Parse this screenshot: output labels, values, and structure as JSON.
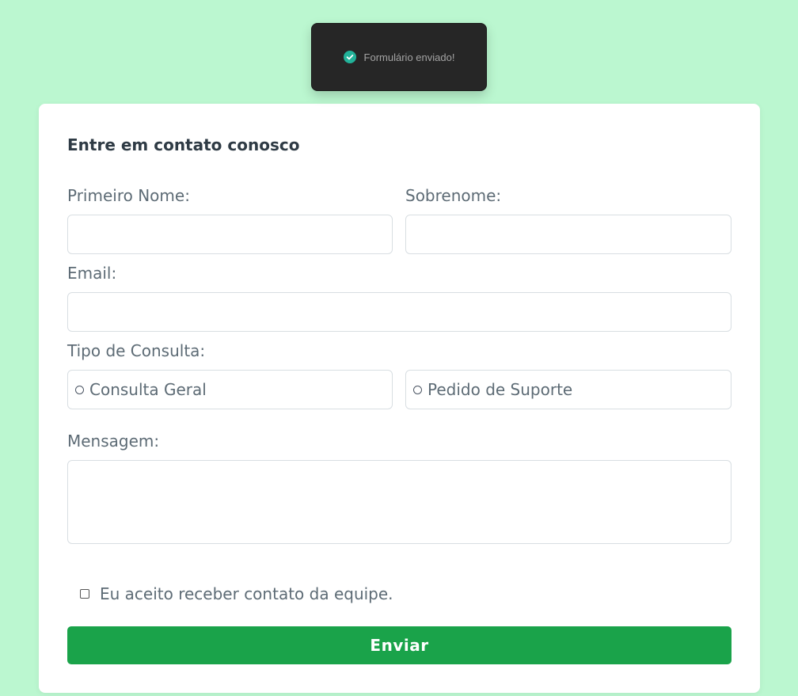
{
  "toast": {
    "message": "Formulário enviado!",
    "icon": "check-circle-icon",
    "icon_color": "#22b39a"
  },
  "form": {
    "title": "Entre em contato conosco",
    "first_name": {
      "label": "Primeiro Nome:",
      "value": ""
    },
    "last_name": {
      "label": "Sobrenome:",
      "value": ""
    },
    "email": {
      "label": "Email:",
      "value": ""
    },
    "query_type": {
      "label": "Tipo de Consulta:",
      "options": [
        "Consulta Geral",
        "Pedido de Suporte"
      ],
      "selected": null
    },
    "message": {
      "label": "Mensagem:",
      "value": ""
    },
    "consent": {
      "label": "Eu aceito receber contato da equipe.",
      "checked": false
    },
    "submit_label": "Enviar"
  },
  "colors": {
    "background": "#bbf7d0",
    "card": "#ffffff",
    "button": "#1aa34a",
    "toast_background": "#262626",
    "label_text": "#5d6b75",
    "title_text": "#2f3b45"
  }
}
